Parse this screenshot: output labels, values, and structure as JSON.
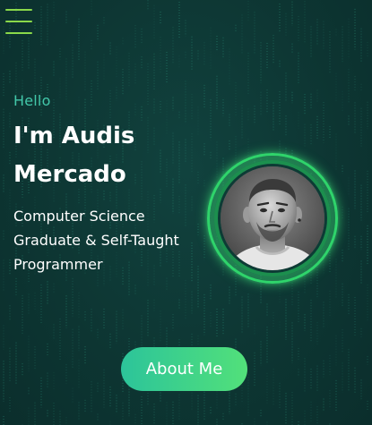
{
  "nav": {
    "menu_icon": "hamburger-menu-icon"
  },
  "hero": {
    "greeting": "Hello",
    "name": "I'm Audis Mercado",
    "tagline": "Computer Science Graduate & Self-Taught Programmer",
    "avatar_alt": "portrait-photo",
    "cta_label": "About Me"
  },
  "colors": {
    "background": "#0e3836",
    "greeting": "#42c7a9",
    "accent_green": "#52e07a",
    "accent_teal": "#2cc49a",
    "menu_icon": "#8ad94a",
    "matrix_rain": "#2a8f78"
  }
}
